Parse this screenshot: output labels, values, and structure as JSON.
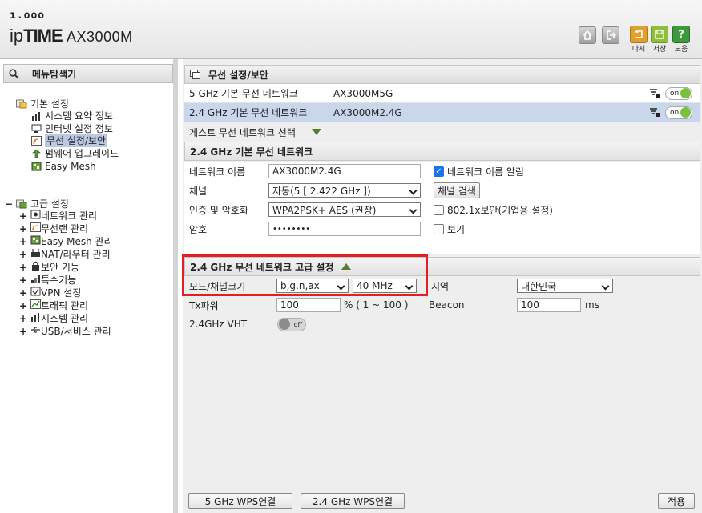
{
  "header": {
    "logo_dots": "ı.ooo",
    "logo_ip": "ip",
    "logo_time": "TIME",
    "model": "AX3000M",
    "buttons": [
      {
        "name": "home",
        "icon": "home-icon"
      },
      {
        "name": "logout",
        "icon": "logout-icon"
      },
      {
        "name": "undo",
        "icon": "undo-icon",
        "label": "다시",
        "color": "#e0a030"
      },
      {
        "name": "save",
        "icon": "save-icon",
        "label": "저장",
        "color": "#8fbf3a"
      },
      {
        "name": "help",
        "icon": "help-icon",
        "label": "도움",
        "color": "#3c9a3c"
      }
    ]
  },
  "sidebar": {
    "title": "메뉴탐색기",
    "basic": {
      "label": "기본 설정",
      "items": [
        {
          "label": "시스템 요약 정보",
          "icon": "chart-icon"
        },
        {
          "label": "인터넷 설정 정보",
          "icon": "monitor-icon"
        },
        {
          "label": "무선 설정/보안",
          "icon": "wifi-icon",
          "selected": true
        },
        {
          "label": "펌웨어 업그레이드",
          "icon": "upgrade-icon"
        },
        {
          "label": "Easy Mesh",
          "icon": "mesh-icon"
        }
      ]
    },
    "advanced": {
      "label": "고급 설정",
      "items": [
        {
          "label": "네트워크 관리",
          "icon": "network-icon"
        },
        {
          "label": "무선랜 관리",
          "icon": "wifi-icon"
        },
        {
          "label": "Easy Mesh 관리",
          "icon": "mesh-icon"
        },
        {
          "label": "NAT/라우터 관리",
          "icon": "router-icon"
        },
        {
          "label": "보안 기능",
          "icon": "lock-icon"
        },
        {
          "label": "특수기능",
          "icon": "special-icon"
        },
        {
          "label": "VPN 설정",
          "icon": "vpn-icon"
        },
        {
          "label": "트래픽 관리",
          "icon": "traffic-icon"
        },
        {
          "label": "시스템 관리",
          "icon": "system-icon"
        },
        {
          "label": "USB/서비스 관리",
          "icon": "usb-icon"
        }
      ]
    }
  },
  "main": {
    "title": "무선 설정/보안",
    "networks": [
      {
        "label": "5 GHz 기본 무선 네트워크",
        "ssid": "AX3000M5G",
        "toggle": "on"
      },
      {
        "label": "2.4 GHz 기본 무선 네트워크",
        "ssid": "AX3000M2.4G",
        "toggle": "on",
        "selected": true
      }
    ],
    "guest_label": "게스트 무선 네트워크 선택",
    "basic_section": {
      "title": "2.4 GHz 기본 무선 네트워크",
      "name_label": "네트워크 이름",
      "name_value": "AX3000M2.4G",
      "broadcast_label": "네트워크 이름 알림",
      "channel_label": "채널",
      "channel_value": "자동(5 [ 2.422 GHz ])",
      "channel_search": "채널 검색",
      "auth_label": "인증 및 암호화",
      "auth_value": "WPA2PSK+ AES (권장)",
      "enterprise_label": "802.1x보안(기업용 설정)",
      "password_label": "암호",
      "password_value": "••••••••",
      "show_label": "보기"
    },
    "advanced_section": {
      "title": "2.4 GHz 무선 네트워크 고급 설정",
      "mode_label": "모드/채널크기",
      "mode_value": "b,g,n,ax",
      "width_value": "40 MHz",
      "region_label": "지역",
      "region_value": "대한민국",
      "tx_label": "Tx파워",
      "tx_value": "100",
      "tx_unit": "% ( 1 ~ 100 )",
      "beacon_label": "Beacon",
      "beacon_value": "100",
      "beacon_unit": "ms",
      "vht_label": "2.4GHz VHT",
      "vht_toggle": "off"
    },
    "footer": {
      "wps5": "5 GHz WPS연결",
      "wps24": "2.4 GHz WPS연결",
      "apply": "적용"
    }
  }
}
